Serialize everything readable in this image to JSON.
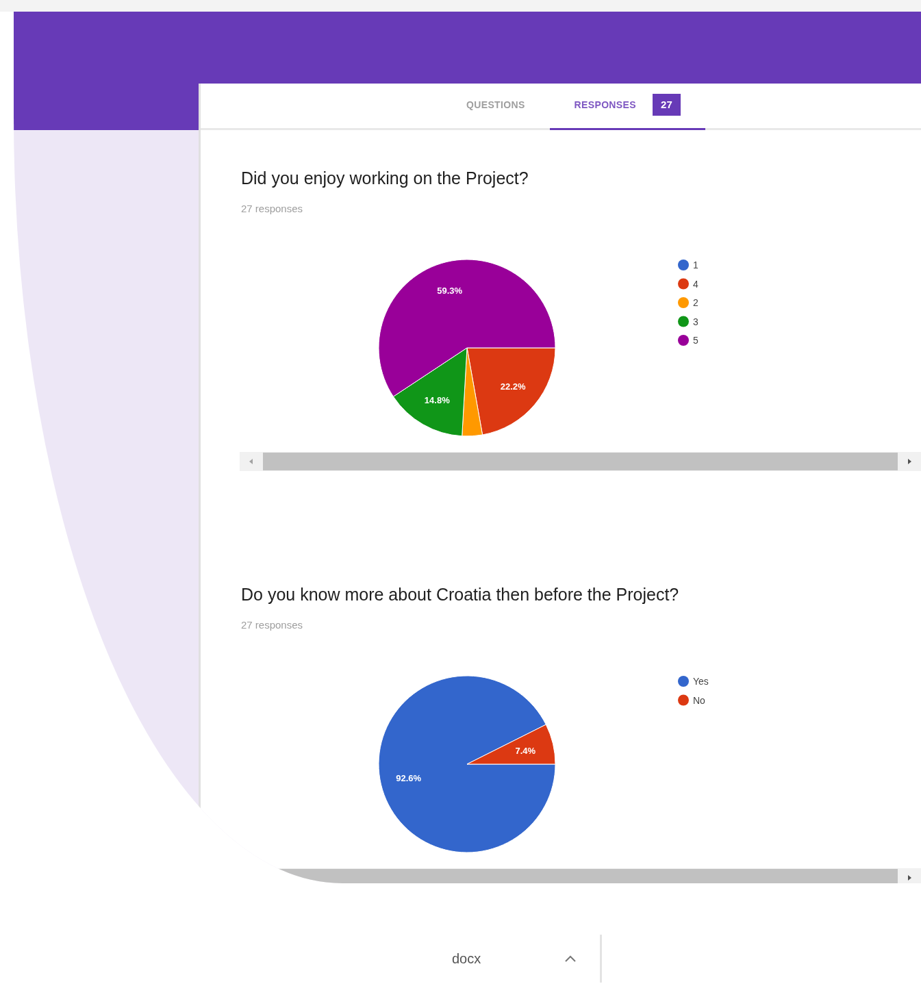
{
  "tabs": [
    {
      "label": "QUESTIONS",
      "selected": false
    },
    {
      "label": "RESPONSES",
      "selected": true,
      "badge": "27"
    }
  ],
  "questions": [
    {
      "title": "Did you enjoy working on the Project?",
      "responses": "27 responses",
      "chart_data": {
        "type": "pie",
        "categories": [
          "1",
          "4",
          "2",
          "3",
          "5"
        ],
        "values": [
          0,
          22.2,
          3.7,
          14.8,
          59.3
        ],
        "colors": [
          "#3366cc",
          "#dc3912",
          "#ff9900",
          "#109618",
          "#990099"
        ],
        "value_labels": [
          null,
          "22.2%",
          null,
          "14.8%",
          "59.3%"
        ],
        "legend": true
      }
    },
    {
      "title": "Do you know more about Croatia then before the Project?",
      "responses": "27 responses",
      "chart_data": {
        "type": "pie",
        "categories": [
          "Yes",
          "No"
        ],
        "values": [
          92.6,
          7.4
        ],
        "colors": [
          "#3366cc",
          "#dc3912"
        ],
        "value_labels": [
          "92.6%",
          "7.4%"
        ],
        "legend": true
      }
    }
  ],
  "download": {
    "filename": "docx"
  }
}
